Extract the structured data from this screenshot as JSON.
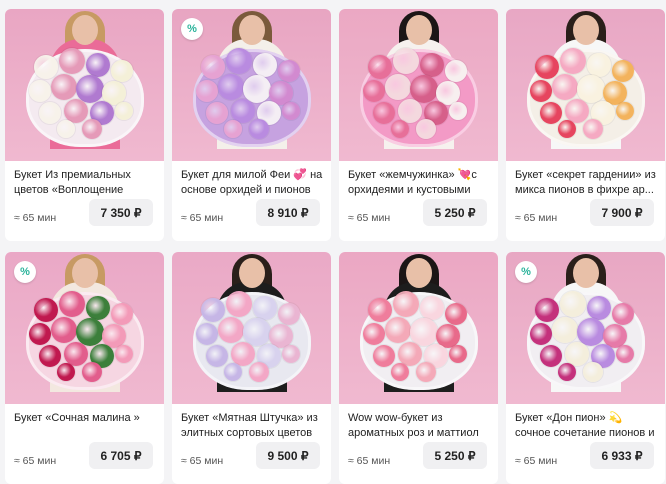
{
  "products": [
    {
      "title": "Букет Из премиальных цветов «Воплощение",
      "time": "≈ 65 мин",
      "price": "7 350 ₽",
      "discount": "",
      "bg": "#e9a6c3",
      "hair": "#c79a63",
      "outfit": "#ea6b98",
      "wrap": "#f4eaf0",
      "flowers": [
        "#f7f2ea",
        "#e59ab8",
        "#b07ad0",
        "#f4f0d8"
      ]
    },
    {
      "title": "Букет для милой Феи 💞 на основе орхидей и пионов",
      "time": "≈ 65 мин",
      "price": "8 910 ₽",
      "discount": "%",
      "bg": "#e8a5c2",
      "hair": "#7a5a3b",
      "outfit": "#f4f0ea",
      "wrap": "#c6a2e0",
      "flowers": [
        "#e6a2d2",
        "#b98be0",
        "#f4eef4",
        "#d28ad0"
      ]
    },
    {
      "title": "Букет «жемчужинка» 💘с орхидеями и кустовыми",
      "time": "≈ 65 мин",
      "price": "5 250 ₽",
      "discount": "",
      "bg": "#eba8c3",
      "hair": "#1c1616",
      "outfit": "#f6f1ee",
      "wrap": "#f39ac6",
      "flowers": [
        "#e76f99",
        "#f4d8de",
        "#d65f8a",
        "#f7efef"
      ]
    },
    {
      "title": "Букет «секрет гардении» из микса пионов в фихре ар...",
      "time": "≈ 65 мин",
      "price": "7 900 ₽",
      "discount": "",
      "bg": "#e8a7c4",
      "hair": "#2a1f1a",
      "outfit": "#f7f7f7",
      "wrap": "#f4efe7",
      "flowers": [
        "#e6455f",
        "#f5a9c2",
        "#f9f2e0",
        "#f3b35d"
      ]
    },
    {
      "title": "Букет «Сочная малина »",
      "time": "≈ 65 мин",
      "price": "6 705 ₽",
      "discount": "%",
      "bg": "#eaa8c6",
      "hair": "#c79a63",
      "outfit": "#f3e8e0",
      "wrap": "#f6d6e2",
      "flowers": [
        "#c0194f",
        "#e25d8c",
        "#3c7f3b",
        "#f39ab8"
      ]
    },
    {
      "title": "Букет «Мятная Штучка» из элитных сортовых цветов",
      "time": "≈ 65 мин",
      "price": "9 500 ₽",
      "discount": "",
      "bg": "#eaa9c6",
      "hair": "#2a1f1a",
      "outfit": "#1d1d1d",
      "wrap": "#e8e8f0",
      "flowers": [
        "#c6b6e6",
        "#f3a7c6",
        "#d8d2ee",
        "#eab5d2"
      ]
    },
    {
      "title": "Wow wow-букет из ароматных роз и маттиол",
      "time": "≈ 65 мин",
      "price": "5 250 ₽",
      "discount": "",
      "bg": "#eba7c3",
      "hair": "#1c1616",
      "outfit": "#1d1d1d",
      "wrap": "#f1eef2",
      "flowers": [
        "#ef7d9c",
        "#f4a9b8",
        "#f9d6df",
        "#e86a8a"
      ]
    },
    {
      "title": "Букет «Дон пион» 💫 сочное сочетание пионов и роз💘",
      "time": "≈ 65 мин",
      "price": "6 933 ₽",
      "discount": "%",
      "bg": "#e8a7c3",
      "hair": "#2a1f1a",
      "outfit": "#f7f7f7",
      "wrap": "#f1eef2",
      "flowers": [
        "#c4317c",
        "#f4eedc",
        "#b98be0",
        "#e67aa8"
      ]
    }
  ]
}
